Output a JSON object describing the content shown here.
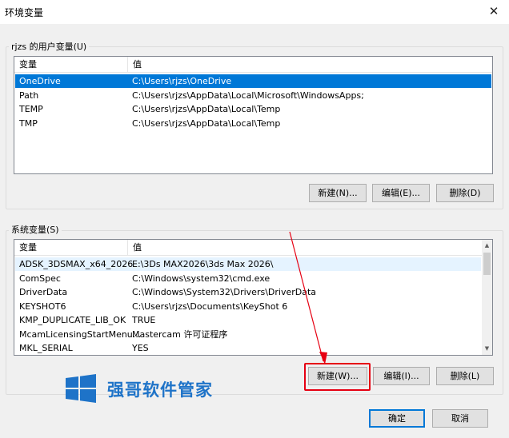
{
  "window": {
    "title": "环境变量",
    "close_glyph": "✕"
  },
  "user_vars": {
    "group_label": "rjzs 的用户变量(U)",
    "columns": [
      "变量",
      "值"
    ],
    "rows": [
      {
        "name": "OneDrive",
        "value": "C:\\Users\\rjzs\\OneDrive",
        "selected": true
      },
      {
        "name": "Path",
        "value": "C:\\Users\\rjzs\\AppData\\Local\\Microsoft\\WindowsApps;"
      },
      {
        "name": "TEMP",
        "value": "C:\\Users\\rjzs\\AppData\\Local\\Temp"
      },
      {
        "name": "TMP",
        "value": "C:\\Users\\rjzs\\AppData\\Local\\Temp"
      }
    ],
    "buttons": {
      "new": "新建(N)...",
      "edit": "编辑(E)...",
      "delete": "删除(D)"
    }
  },
  "system_vars": {
    "group_label": "系统变量(S)",
    "columns": [
      "变量",
      "值"
    ],
    "rows": [
      {
        "name": "ADSK_3DSMAX_x64_2026",
        "value": "E:\\3Ds MAX2026\\3ds Max 2026\\",
        "hot": true
      },
      {
        "name": "ComSpec",
        "value": "C:\\Windows\\system32\\cmd.exe"
      },
      {
        "name": "DriverData",
        "value": "C:\\Windows\\System32\\Drivers\\DriverData"
      },
      {
        "name": "KEYSHOT6",
        "value": "C:\\Users\\rjzs\\Documents\\KeyShot 6"
      },
      {
        "name": "KMP_DUPLICATE_LIB_OK",
        "value": "TRUE"
      },
      {
        "name": "McamLicensingStartMenu...",
        "value": "Mastercam 许可证程序"
      },
      {
        "name": "MKL_SERIAL",
        "value": "YES"
      }
    ],
    "buttons": {
      "new": "新建(W)...",
      "edit": "编辑(I)...",
      "delete": "删除(L)"
    },
    "scroll_position": 0
  },
  "footer": {
    "ok": "确定",
    "cancel": "取消"
  },
  "watermark": {
    "text": "强哥软件管家"
  },
  "colors": {
    "selection": "#0078d7",
    "hover_row": "#e5f3ff",
    "annotation": "#e60012",
    "watermark_blue": "#1e73c8"
  },
  "icons": {
    "close": "close-icon",
    "scroll_up": "arrow-up-icon",
    "scroll_down": "arrow-down-icon",
    "logo": "windows-logo-icon",
    "annotation_arrow": "red-arrow-icon"
  }
}
